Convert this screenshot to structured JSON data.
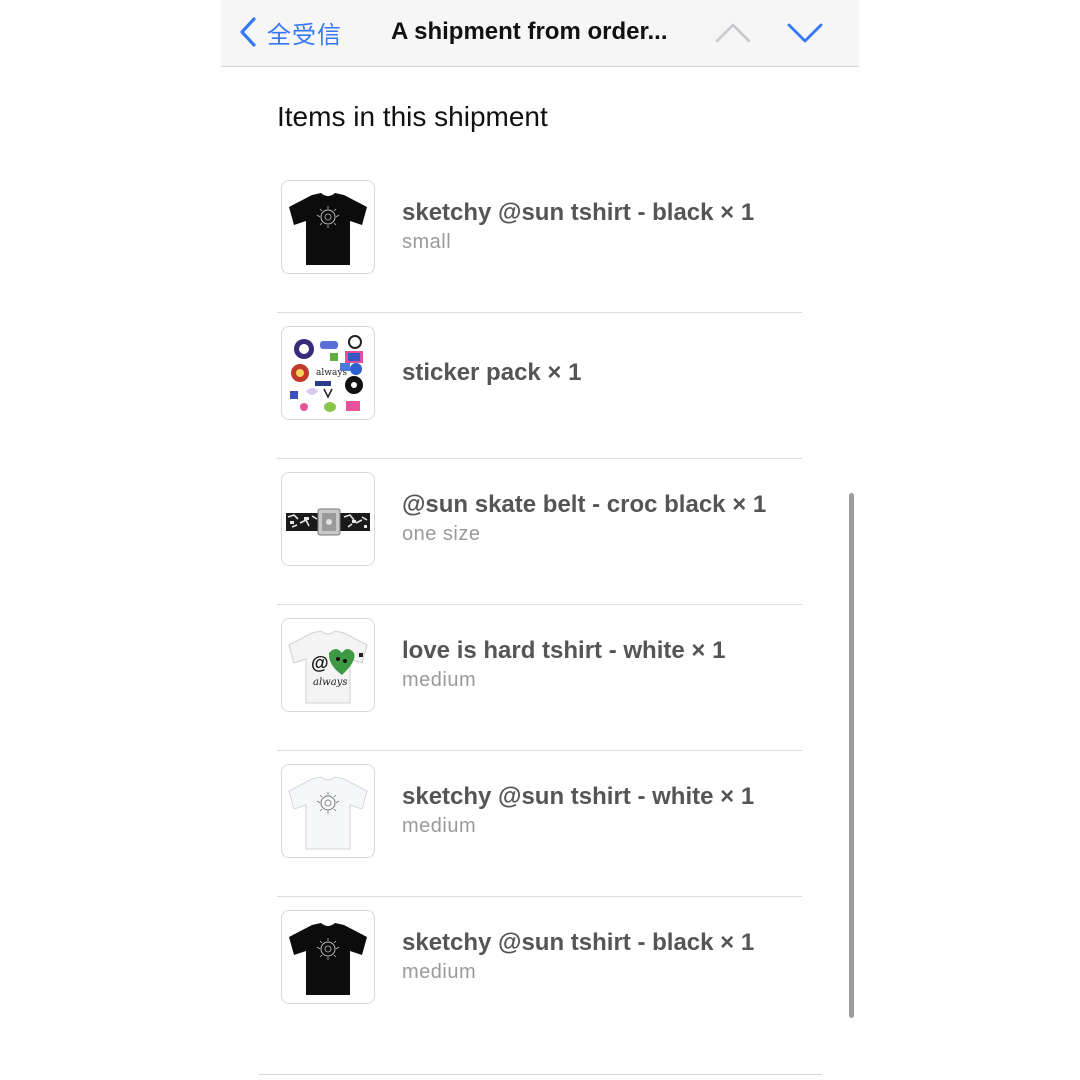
{
  "navbar": {
    "back_label": "全受信",
    "title": "A shipment from order...",
    "up_icon": "chevron-up-icon",
    "down_icon": "chevron-down-icon",
    "accent_color": "#3478f6"
  },
  "section": {
    "title": "Items in this shipment"
  },
  "items": [
    {
      "name": "sketchy @sun tshirt - black × 1",
      "variant": "small",
      "thumbnail": "black-tshirt-image"
    },
    {
      "name": "sticker pack × 1",
      "variant": "",
      "thumbnail": "sticker-pack-image"
    },
    {
      "name": "@sun skate belt - croc black × 1",
      "variant": "one size",
      "thumbnail": "croc-belt-image"
    },
    {
      "name": "love is hard tshirt - white × 1",
      "variant": "medium",
      "thumbnail": "white-tshirt-heart-image"
    },
    {
      "name": "sketchy @sun tshirt - white × 1",
      "variant": "medium",
      "thumbnail": "white-tshirt-image"
    },
    {
      "name": "sketchy @sun tshirt - black × 1",
      "variant": "medium",
      "thumbnail": "black-tshirt-image"
    }
  ]
}
